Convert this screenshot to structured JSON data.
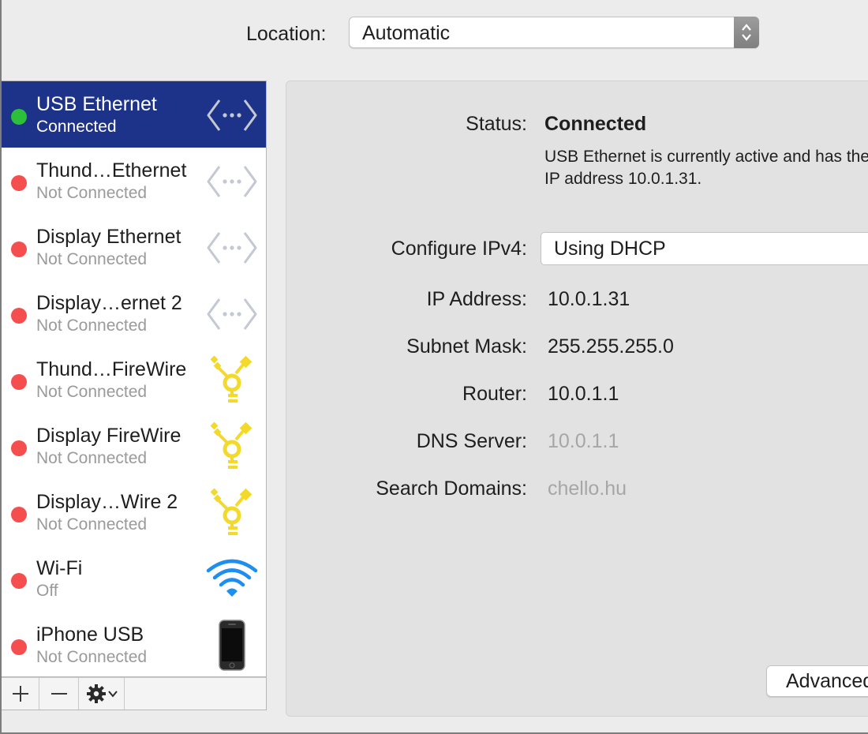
{
  "location": {
    "label": "Location:",
    "value": "Automatic"
  },
  "services": [
    {
      "name": "USB Ethernet",
      "status": "Connected",
      "dot": "green",
      "icon": "ethernet-icon",
      "selected": true
    },
    {
      "name": "Thund…Ethernet",
      "status": "Not Connected",
      "dot": "red",
      "icon": "ethernet-icon"
    },
    {
      "name": "Display Ethernet",
      "status": "Not Connected",
      "dot": "red",
      "icon": "ethernet-icon"
    },
    {
      "name": "Display…ernet 2",
      "status": "Not Connected",
      "dot": "red",
      "icon": "ethernet-icon"
    },
    {
      "name": "Thund…FireWire",
      "status": "Not Connected",
      "dot": "red",
      "icon": "firewire-icon"
    },
    {
      "name": "Display FireWire",
      "status": "Not Connected",
      "dot": "red",
      "icon": "firewire-icon"
    },
    {
      "name": "Display…Wire 2",
      "status": "Not Connected",
      "dot": "red",
      "icon": "firewire-icon"
    },
    {
      "name": "Wi-Fi",
      "status": "Off",
      "dot": "red",
      "icon": "wifi-icon"
    },
    {
      "name": "iPhone USB",
      "status": "Not Connected",
      "dot": "red",
      "icon": "iphone-icon"
    }
  ],
  "toolbar": {
    "add": "+",
    "remove": "—"
  },
  "detail": {
    "status_label": "Status:",
    "status_value": "Connected",
    "status_desc_line1": "USB Ethernet is currently active and has the",
    "status_desc_line2": "IP address 10.0.1.31.",
    "configure_label": "Configure IPv4:",
    "configure_value": "Using DHCP",
    "ip_label": "IP Address:",
    "ip_value": "10.0.1.31",
    "subnet_label": "Subnet Mask:",
    "subnet_value": "255.255.255.0",
    "router_label": "Router:",
    "router_value": "10.0.1.1",
    "dns_label": "DNS Server:",
    "dns_value": "10.0.1.1",
    "search_label": "Search Domains:",
    "search_value": "chello.hu",
    "advanced_label": "Advanced..."
  },
  "colors": {
    "selected_row": "#1d3389",
    "connected_dot": "#2cc03a",
    "disconnected_dot": "#f54e4e",
    "firewire_yellow": "#f2d92c",
    "wifi_blue": "#1e8ff0"
  }
}
